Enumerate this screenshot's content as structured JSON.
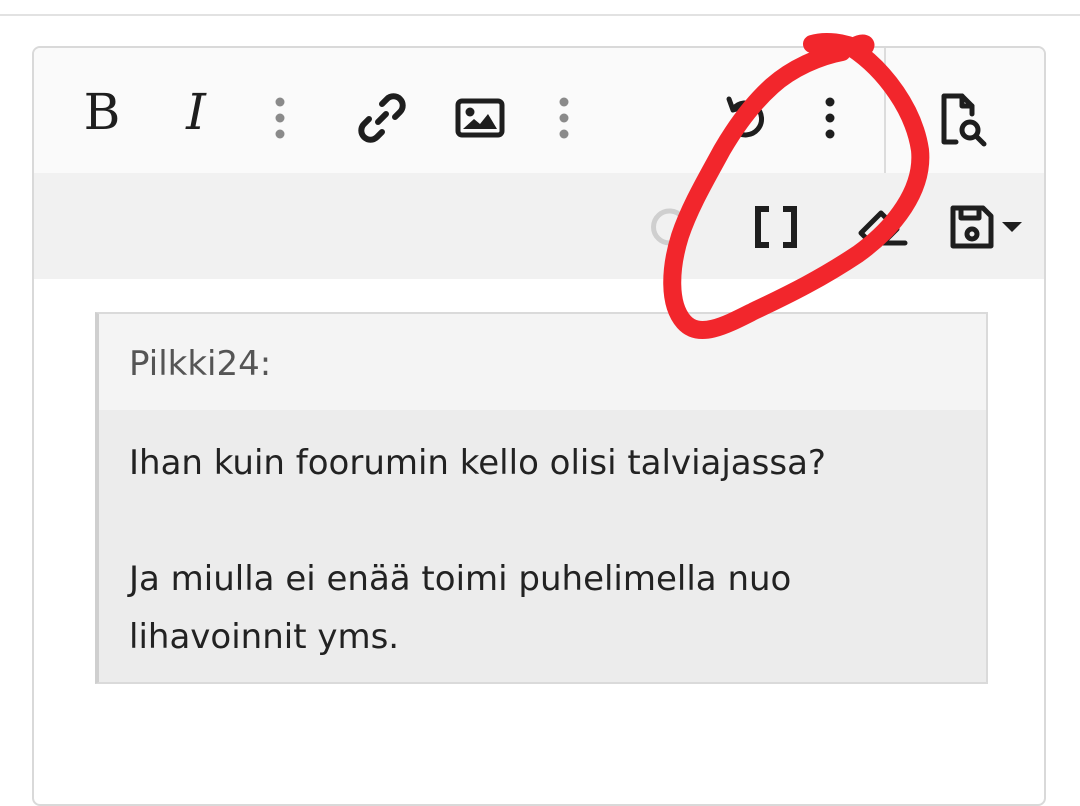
{
  "toolbar": {
    "primary": [
      {
        "name": "bold",
        "label": "B",
        "icon": "bold-icon"
      },
      {
        "name": "italic",
        "label": "I",
        "icon": "italic-icon"
      },
      {
        "name": "more-text",
        "icon": "vertical-dots-icon"
      },
      {
        "name": "link",
        "icon": "link-icon"
      },
      {
        "name": "image",
        "icon": "image-icon"
      },
      {
        "name": "more-insert",
        "icon": "vertical-dots-icon"
      },
      {
        "name": "undo",
        "icon": "undo-icon"
      },
      {
        "name": "more-options",
        "icon": "vertical-dots-icon"
      },
      {
        "name": "preview",
        "icon": "preview-icon"
      }
    ],
    "secondary": [
      {
        "name": "redo",
        "icon": "redo-icon",
        "disabled": true
      },
      {
        "name": "bbcode-toggle",
        "label": "[ ]",
        "icon": "brackets-icon"
      },
      {
        "name": "remove-formatting",
        "icon": "eraser-icon"
      },
      {
        "name": "drafts",
        "icon": "save-icon"
      }
    ]
  },
  "quote": {
    "author": "Pilkki24:",
    "lines": [
      "Ihan kuin foorumin kello olisi talviajassa?",
      "Ja miulla ei enää toimi puhelimella nuo lihavoinnit yms."
    ]
  },
  "annotation": {
    "type": "hand-drawn circle",
    "color": "#f2262c"
  },
  "colors": {
    "toolbar_bg": "#fafafa",
    "secondary_toolbar_bg": "#f1f1f1",
    "quote_bg": "#ececec",
    "icon": "#1e1e1e",
    "muted_icon": "#8a8a8a"
  }
}
